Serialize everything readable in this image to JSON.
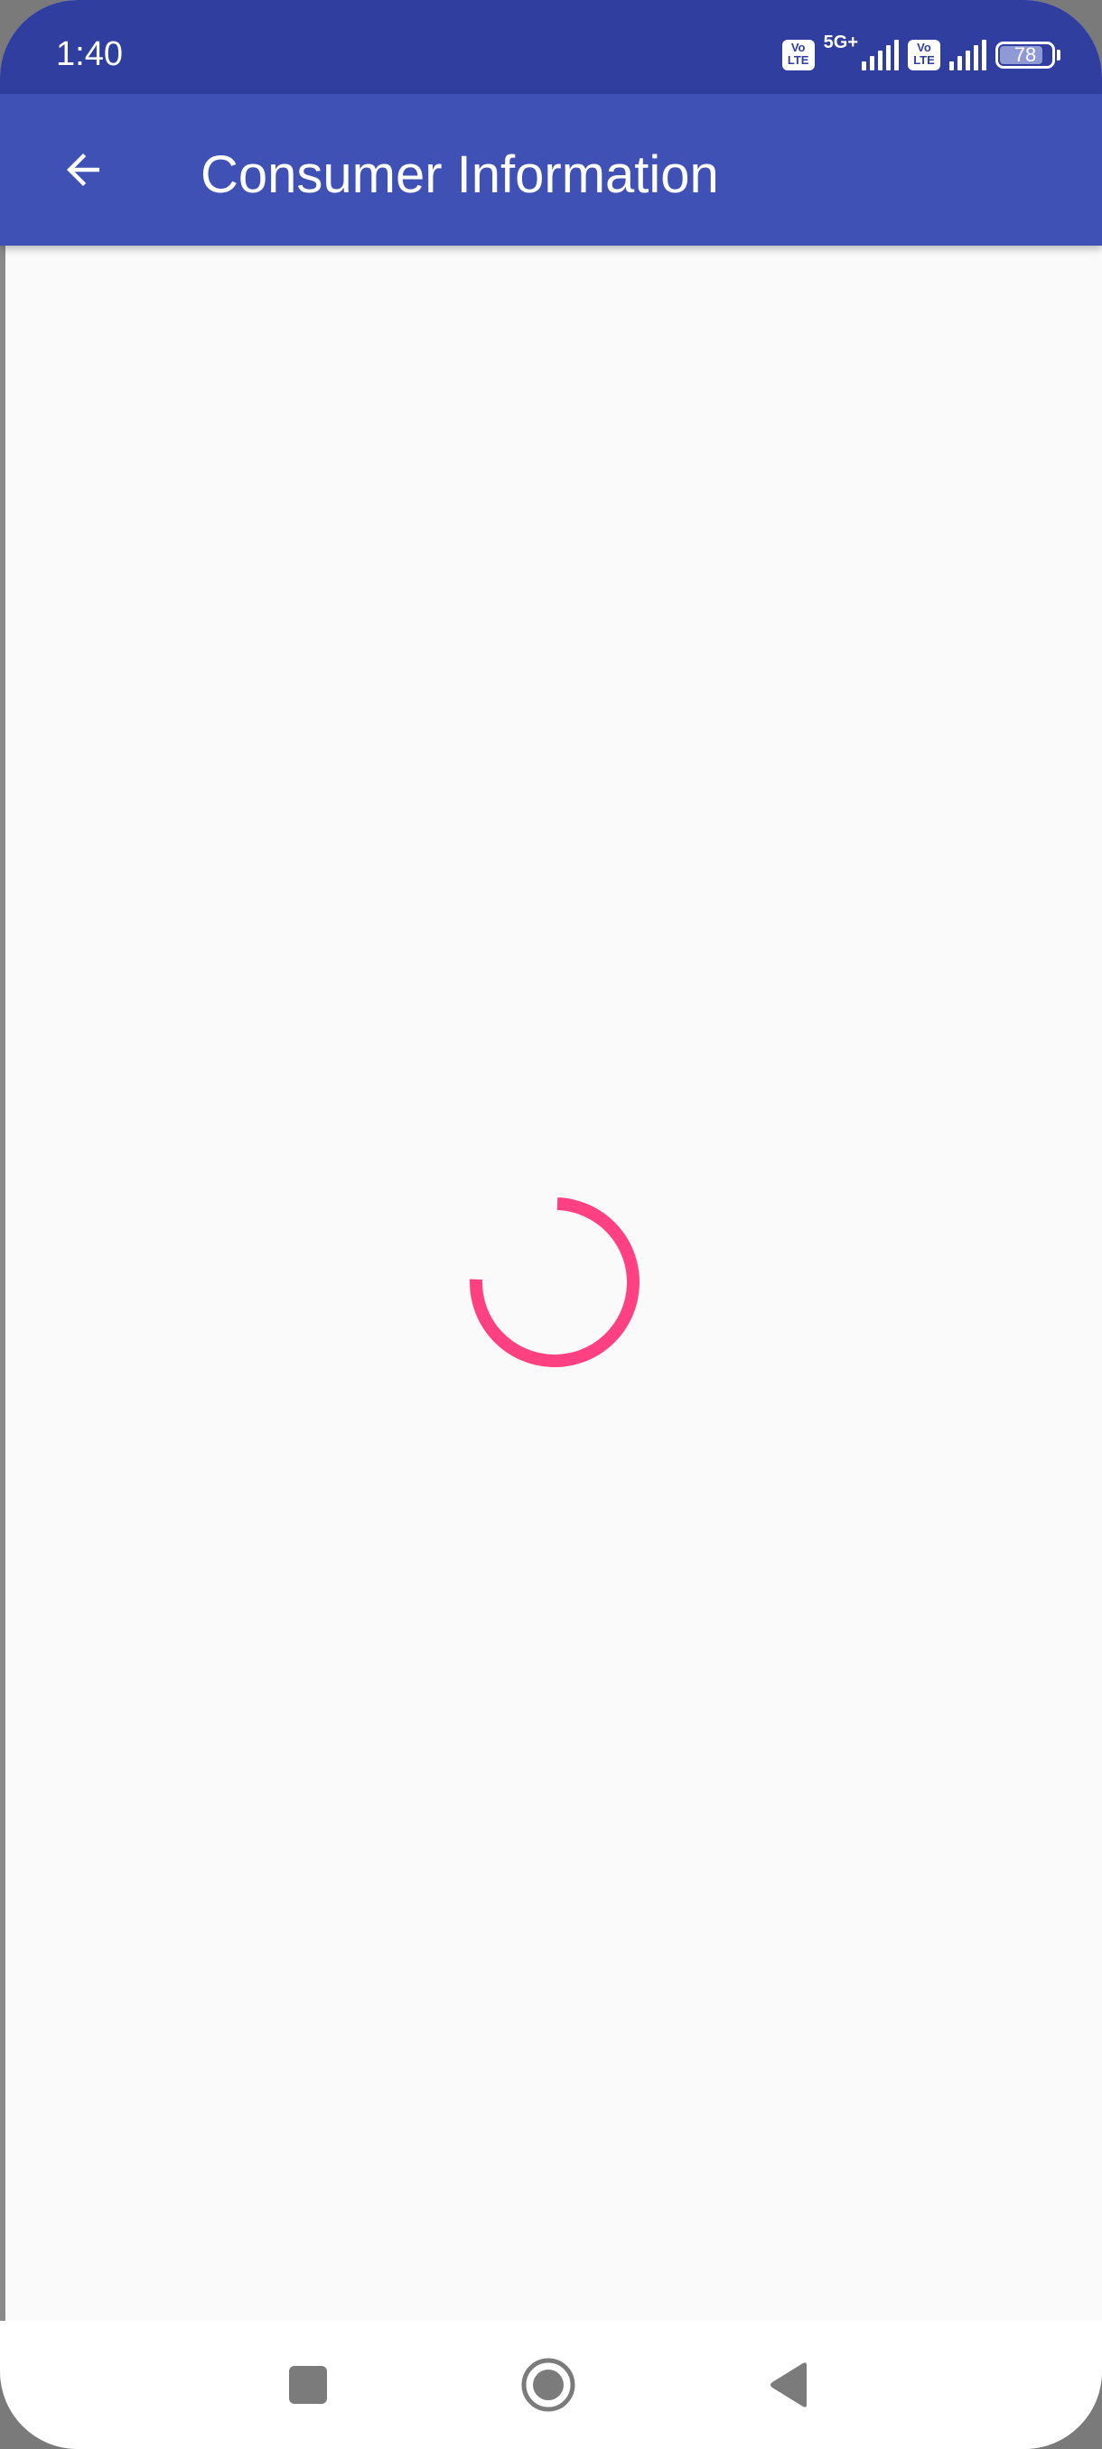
{
  "status_bar": {
    "time": "1:40",
    "network_label": "5G+",
    "volte_label_1": "Vo LTE",
    "volte_label_2": "Vo LTE",
    "battery_level": "78",
    "background": "#303f9f"
  },
  "app_bar": {
    "title": "Consumer Information",
    "back_icon": "arrow-left-icon",
    "background": "#3f51b5"
  },
  "content": {
    "loading": true,
    "spinner_color": "#ff4081",
    "background": "#fafafa"
  },
  "nav_bar": {
    "recents_icon": "square-icon",
    "home_icon": "circle-icon",
    "back_icon": "triangle-back-icon"
  }
}
